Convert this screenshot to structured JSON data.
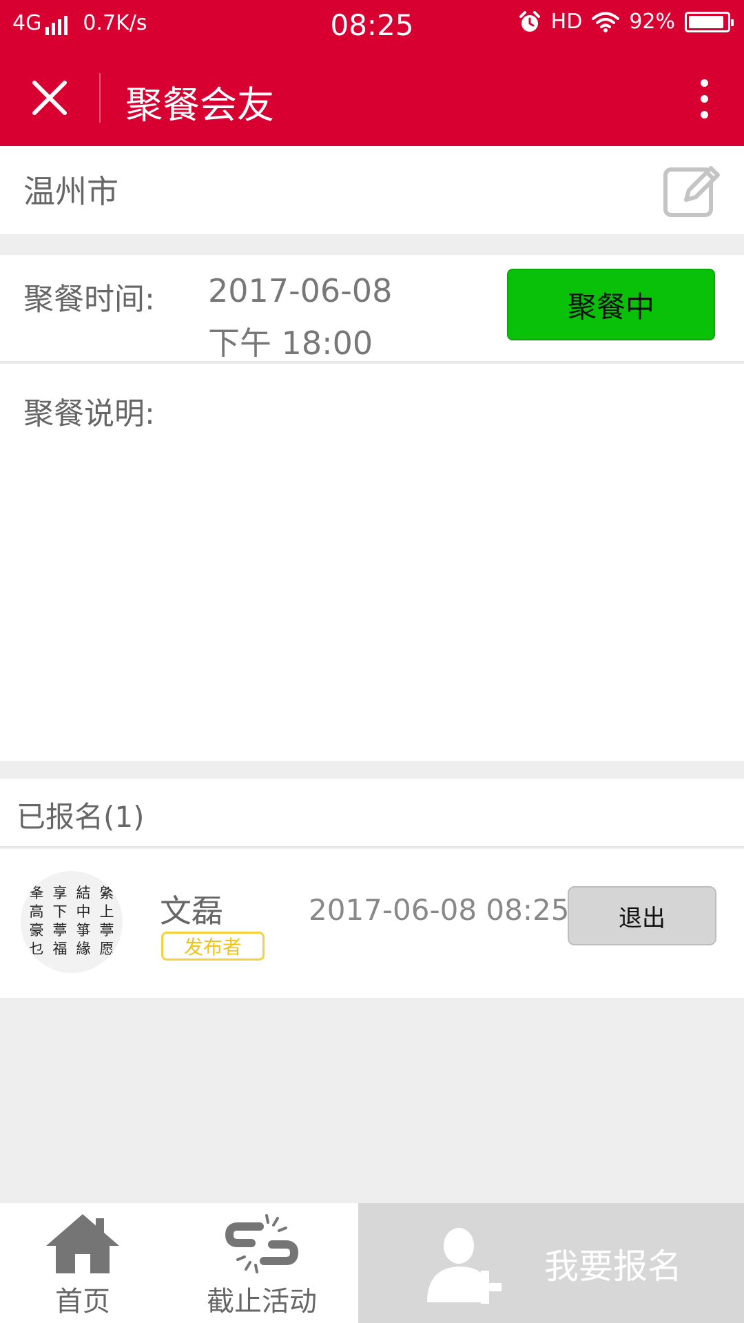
{
  "status_bar": {
    "network": "4G",
    "speed": "0.7K/s",
    "time": "08:25",
    "hd": "HD",
    "battery": "92%",
    "battery_level": 0.92
  },
  "header": {
    "title": "聚餐会友",
    "icons": [
      "close-icon",
      "more-icon"
    ],
    "color": "#d70031"
  },
  "location": {
    "city": "温州市",
    "icon": "edit-icon"
  },
  "event": {
    "time_label": "聚餐时间:",
    "date": "2017-06-08",
    "time": "下午 18:00",
    "status_label": "聚餐中",
    "status_color": "#0ac10a",
    "description_label": "聚餐说明:",
    "description": ""
  },
  "signups": {
    "header": "已报名(1)",
    "items": [
      {
        "name": "文磊",
        "badge": "发布者",
        "time": "2017-06-08 08:25",
        "action_label": "退出",
        "avatar_text": "夆享結綮高下中上豪葶箏葶乜福緣愿"
      }
    ]
  },
  "bottom_nav": {
    "home_label": "首页",
    "home_icon": "home-icon",
    "stop_label": "截止活动",
    "stop_icon": "broken-link-icon",
    "signup_label": "我要报名",
    "signup_icon": "add-user-icon"
  }
}
